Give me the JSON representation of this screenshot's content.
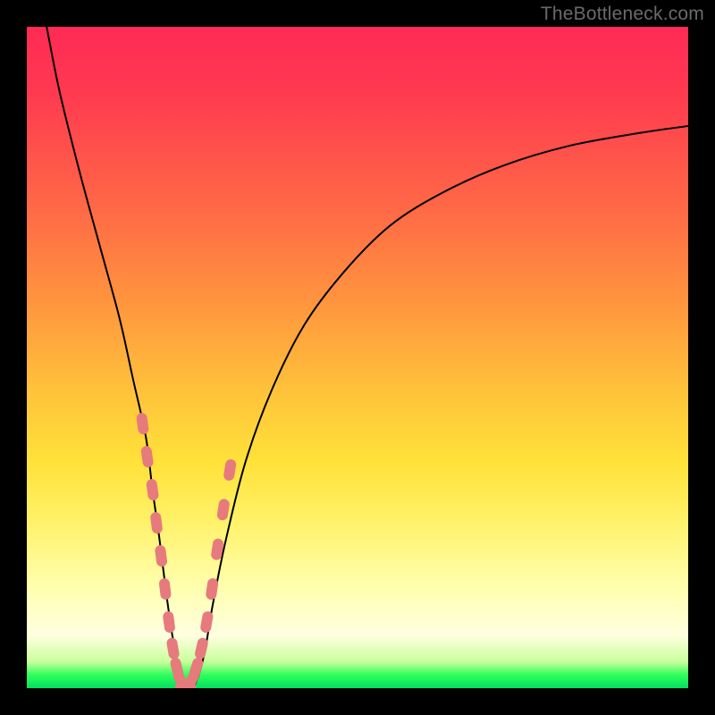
{
  "watermark": "TheBottleneck.com",
  "chart_data": {
    "type": "line",
    "title": "",
    "xlabel": "",
    "ylabel": "",
    "xlim": [
      0,
      100
    ],
    "ylim": [
      0,
      100
    ],
    "series": [
      {
        "name": "curve",
        "x": [
          3,
          5,
          8,
          11,
          14,
          16,
          18,
          19,
          20,
          21,
          22,
          23,
          24,
          25,
          26,
          27,
          28,
          30,
          33,
          37,
          42,
          48,
          55,
          63,
          72,
          82,
          93,
          100
        ],
        "values": [
          100,
          90,
          78,
          67,
          56,
          47,
          38,
          30,
          23,
          15,
          8,
          3,
          0,
          0,
          2,
          6,
          12,
          22,
          34,
          45,
          55,
          63,
          70,
          75,
          79,
          82,
          84,
          85
        ]
      }
    ],
    "markers": {
      "name": "highlighted-points",
      "color": "#e77a7d",
      "x": [
        17.5,
        18.2,
        19.0,
        19.6,
        20.3,
        20.9,
        21.5,
        22.1,
        22.7,
        23.3,
        24.0,
        24.8,
        25.6,
        26.4,
        27.2,
        28.0,
        28.8,
        29.7,
        30.7
      ],
      "values": [
        40,
        35,
        30,
        25,
        20,
        15,
        10,
        6,
        3,
        1,
        0,
        1,
        3,
        6,
        10,
        15,
        21,
        27,
        33
      ]
    }
  }
}
